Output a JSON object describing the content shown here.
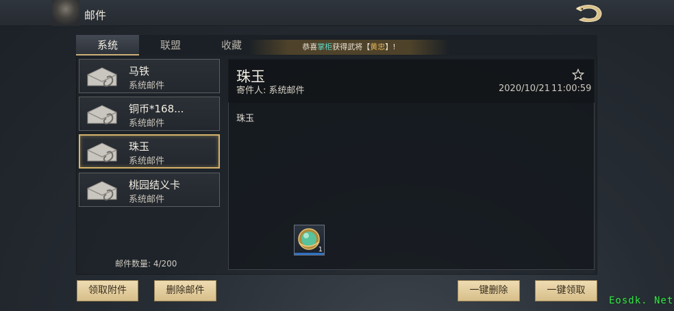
{
  "header": {
    "title": "邮件",
    "back_icon": "dragon-back-icon"
  },
  "tabs": [
    {
      "label": "系统",
      "active": true
    },
    {
      "label": "联盟",
      "active": false
    },
    {
      "label": "收藏",
      "active": false
    }
  ],
  "ticker": {
    "prefix": "恭喜",
    "name": "掌柜",
    "mid": "获得武将【",
    "general": "黄忠",
    "suffix": "】!"
  },
  "mail_list": [
    {
      "title": "马铁",
      "subtitle": "系统邮件",
      "selected": false
    },
    {
      "title": "铜币*168...",
      "subtitle": "系统邮件",
      "selected": false
    },
    {
      "title": "珠玉",
      "subtitle": "系统邮件",
      "selected": true
    },
    {
      "title": "桃园结义卡",
      "subtitle": "系统邮件",
      "selected": false
    }
  ],
  "mail_count": "邮件数量: 4/200",
  "detail": {
    "title": "珠玉",
    "sender_label": "寄件人: 系统邮件",
    "date": "2020/10/21",
    "time": "11:00:59",
    "body": "珠玉",
    "attachment": {
      "icon": "jade-orb-icon",
      "qty": "1"
    }
  },
  "buttons": {
    "claim_attachment": "领取附件",
    "delete_mail": "删除邮件",
    "delete_all": "一键删除",
    "claim_all": "一键领取"
  },
  "watermark": "Eosdk. Net",
  "colors": {
    "accent_gold": "#d6b46a",
    "button_bg": "#e6d1a0",
    "highlight": "#5fd3c4"
  }
}
